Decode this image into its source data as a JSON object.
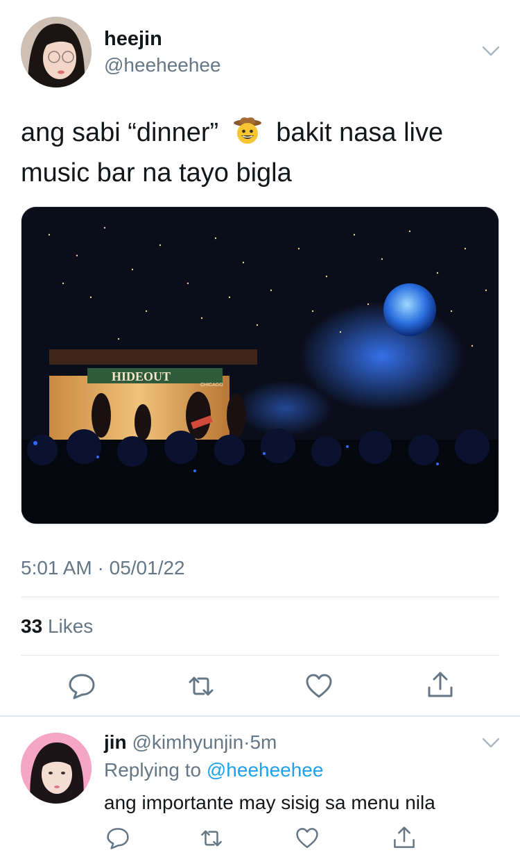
{
  "tweet": {
    "author": {
      "name": "heejin",
      "handle": "@heeheehee"
    },
    "text_before": "ang sabi “dinner”",
    "emoji": "cowboy-hat-face-emoji",
    "text_after": "bakit nasa live music bar na tayo bigla",
    "media": {
      "sign_text": "HIDEOUT",
      "sign_small": "CHICAGO"
    },
    "time": "5:01 AM",
    "date_sep": "·",
    "date": "05/01/22",
    "likes_count": "33",
    "likes_label": "Likes",
    "actions": [
      "reply-icon",
      "retweet-icon",
      "like-icon",
      "share-icon"
    ]
  },
  "reply": {
    "author": {
      "name": "jin",
      "handle": "@kimhyunjin",
      "sep": "·",
      "time": "5m"
    },
    "replying_prefix": "Replying to",
    "replying_to": "@heeheehee",
    "text": "ang importante may sisig sa menu nila",
    "actions": [
      "reply-icon",
      "retweet-icon",
      "like-icon",
      "share-icon"
    ]
  },
  "colors": {
    "text": "#14171a",
    "secondary": "#657786",
    "link": "#1da1f2",
    "divider": "#e1e8ed",
    "icon": "#657786"
  }
}
